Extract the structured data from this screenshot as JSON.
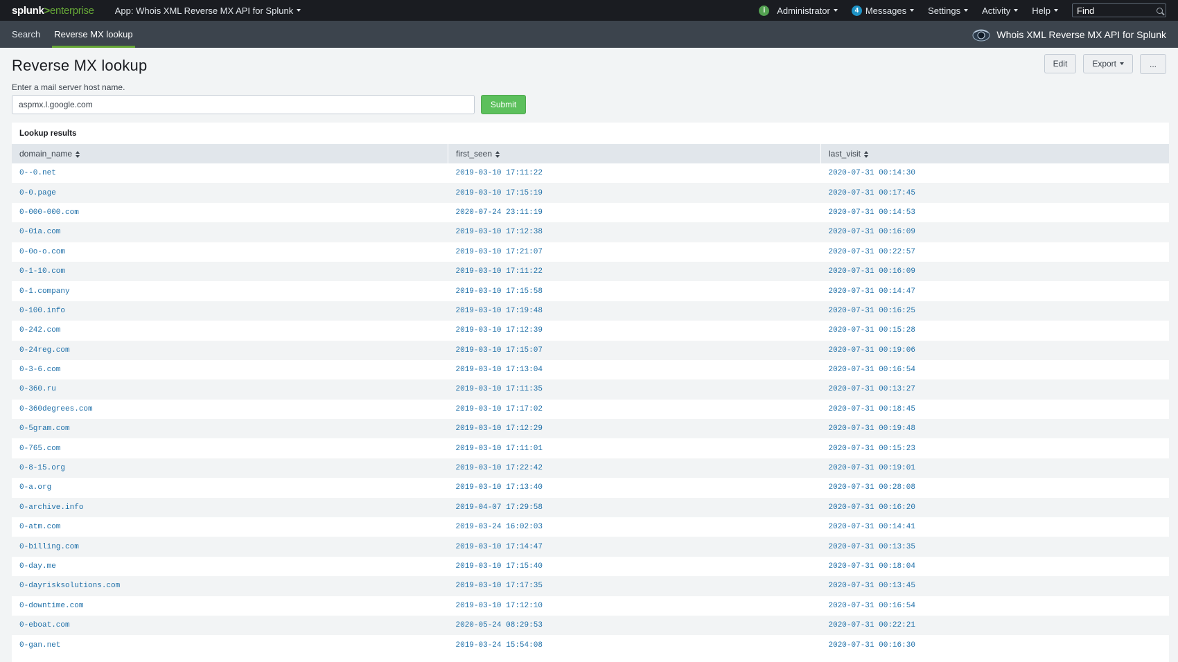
{
  "topbar": {
    "logo_brand": "splunk",
    "logo_sep": ">",
    "logo_product": "enterprise",
    "app_label": "App: Whois XML Reverse MX API for Splunk",
    "status_icon": "i",
    "user": "Administrator",
    "messages_count": "4",
    "messages_label": "Messages",
    "settings": "Settings",
    "activity": "Activity",
    "help": "Help",
    "find_placeholder": "Find"
  },
  "appbar": {
    "tabs": [
      {
        "label": "Search",
        "active": false
      },
      {
        "label": "Reverse MX lookup",
        "active": true
      }
    ],
    "app_title": "Whois XML Reverse MX API for Splunk"
  },
  "dashboard": {
    "title": "Reverse MX lookup",
    "edit_label": "Edit",
    "export_label": "Export",
    "more_label": "...",
    "input_label": "Enter a mail server host name.",
    "input_value": "aspmx.l.google.com",
    "submit_label": "Submit"
  },
  "panel": {
    "title": "Lookup results",
    "columns": [
      "domain_name",
      "first_seen",
      "last_visit"
    ],
    "rows": [
      [
        "0--0.net",
        "2019-03-10 17:11:22",
        "2020-07-31 00:14:30"
      ],
      [
        "0-0.page",
        "2019-03-10 17:15:19",
        "2020-07-31 00:17:45"
      ],
      [
        "0-000-000.com",
        "2020-07-24 23:11:19",
        "2020-07-31 00:14:53"
      ],
      [
        "0-01a.com",
        "2019-03-10 17:12:38",
        "2020-07-31 00:16:09"
      ],
      [
        "0-0o-o.com",
        "2019-03-10 17:21:07",
        "2020-07-31 00:22:57"
      ],
      [
        "0-1-10.com",
        "2019-03-10 17:11:22",
        "2020-07-31 00:16:09"
      ],
      [
        "0-1.company",
        "2019-03-10 17:15:58",
        "2020-07-31 00:14:47"
      ],
      [
        "0-100.info",
        "2019-03-10 17:19:48",
        "2020-07-31 00:16:25"
      ],
      [
        "0-242.com",
        "2019-03-10 17:12:39",
        "2020-07-31 00:15:28"
      ],
      [
        "0-24reg.com",
        "2019-03-10 17:15:07",
        "2020-07-31 00:19:06"
      ],
      [
        "0-3-6.com",
        "2019-03-10 17:13:04",
        "2020-07-31 00:16:54"
      ],
      [
        "0-360.ru",
        "2019-03-10 17:11:35",
        "2020-07-31 00:13:27"
      ],
      [
        "0-360degrees.com",
        "2019-03-10 17:17:02",
        "2020-07-31 00:18:45"
      ],
      [
        "0-5gram.com",
        "2019-03-10 17:12:29",
        "2020-07-31 00:19:48"
      ],
      [
        "0-765.com",
        "2019-03-10 17:11:01",
        "2020-07-31 00:15:23"
      ],
      [
        "0-8-15.org",
        "2019-03-10 17:22:42",
        "2020-07-31 00:19:01"
      ],
      [
        "0-a.org",
        "2019-03-10 17:13:40",
        "2020-07-31 00:28:08"
      ],
      [
        "0-archive.info",
        "2019-04-07 17:29:58",
        "2020-07-31 00:16:20"
      ],
      [
        "0-atm.com",
        "2019-03-24 16:02:03",
        "2020-07-31 00:14:41"
      ],
      [
        "0-billing.com",
        "2019-03-10 17:14:47",
        "2020-07-31 00:13:35"
      ],
      [
        "0-day.me",
        "2019-03-10 17:15:40",
        "2020-07-31 00:18:04"
      ],
      [
        "0-dayrisksolutions.com",
        "2019-03-10 17:17:35",
        "2020-07-31 00:13:45"
      ],
      [
        "0-downtime.com",
        "2019-03-10 17:12:10",
        "2020-07-31 00:16:54"
      ],
      [
        "0-eboat.com",
        "2020-05-24 08:29:53",
        "2020-07-31 00:22:21"
      ],
      [
        "0-gan.net",
        "2019-03-24 15:54:08",
        "2020-07-31 00:16:30"
      ]
    ]
  }
}
